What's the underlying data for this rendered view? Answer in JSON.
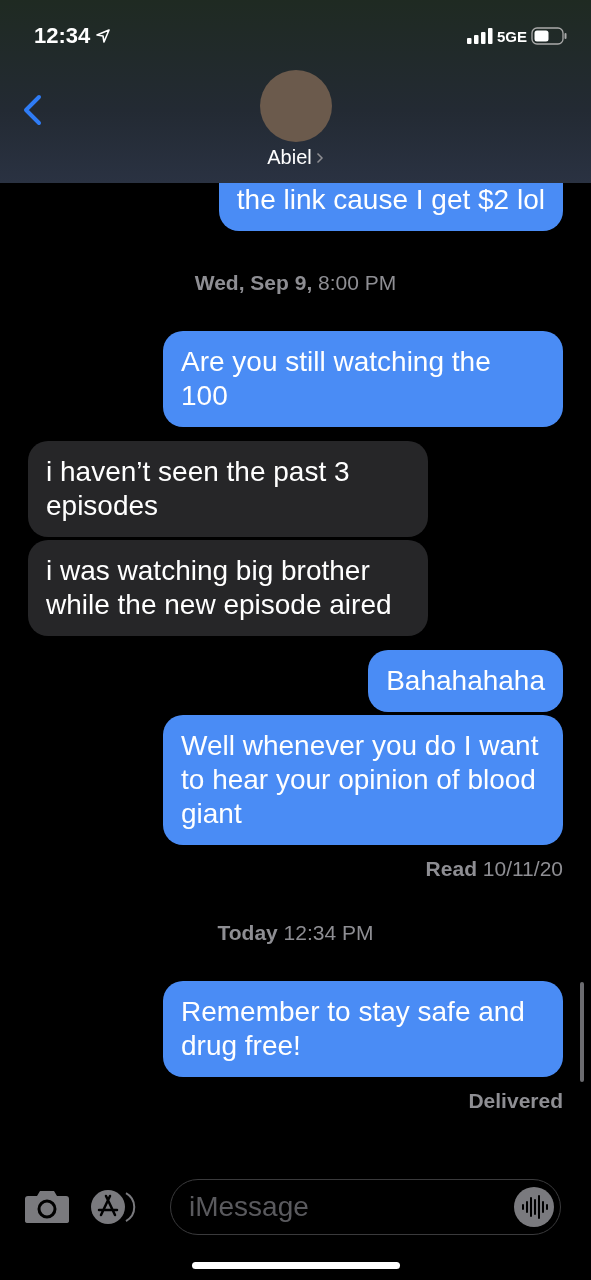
{
  "status_bar": {
    "time": "12:34",
    "network": "5GE"
  },
  "header": {
    "contact_name": "Abiel"
  },
  "messages": [
    {
      "kind": "outgoing",
      "text": "the link cause I get $2 lol",
      "cut_top": true
    },
    {
      "kind": "timestamp",
      "text": "**Wed, Sep 9,** 8:00 PM"
    },
    {
      "kind": "outgoing",
      "text": "Are you still watching the 100"
    },
    {
      "kind": "incoming",
      "text": "i haven’t seen the past 3 episodes"
    },
    {
      "kind": "incoming",
      "text": "i was watching big brother while the new episode aired"
    },
    {
      "kind": "outgoing",
      "text": "Bahahahaha"
    },
    {
      "kind": "outgoing",
      "text": "Well whenever you do I want to hear your opinion of blood giant"
    },
    {
      "kind": "receipt",
      "text": "**Read** 10/11/20"
    },
    {
      "kind": "timestamp",
      "text": "**Today** 12:34 PM"
    },
    {
      "kind": "outgoing",
      "text": "Remember to stay safe and drug free!"
    },
    {
      "kind": "receipt",
      "text": "**Delivered**"
    }
  ],
  "composer": {
    "placeholder": "iMessage"
  }
}
